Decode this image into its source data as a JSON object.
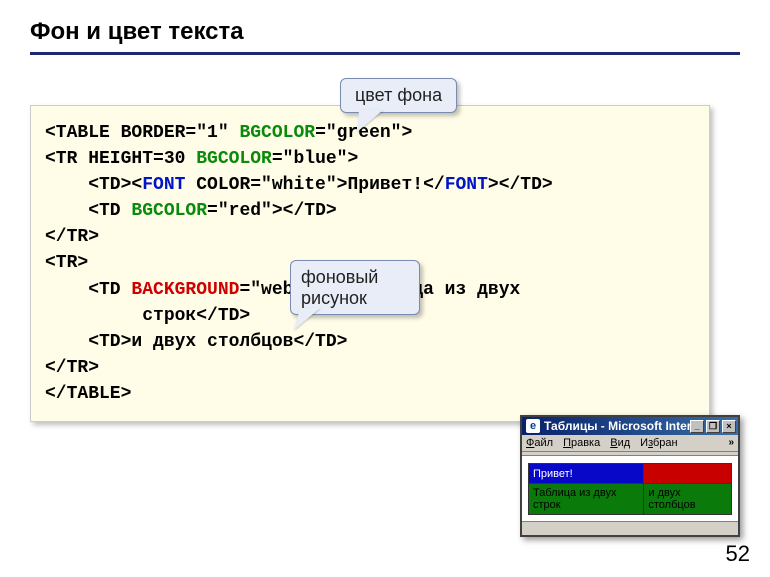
{
  "title": "Фон и цвет текста",
  "pagenum": "52",
  "callouts": {
    "c1": "цвет фона",
    "c2": "фоновый рисунок"
  },
  "code": {
    "l1a": "<TABLE BORDER=\"1\" ",
    "l1b": "BGCOLOR",
    "l1c": "=\"green\">",
    "l2a": "<TR HEIGHT=30 ",
    "l2b": "BGCOLOR",
    "l2c": "=\"blue\">",
    "l3a": "    <TD><",
    "l3b": "FONT",
    "l3c": " COLOR=\"white\">Привет!</",
    "l3d": "FONT",
    "l3e": "></TD>",
    "l4a": "    <TD ",
    "l4b": "BGCOLOR",
    "l4c": "=\"red\"></TD>",
    "l5": "</TR>",
    "l6": "<TR>",
    "l7a": "    <TD ",
    "l7b": "BACKGROUND",
    "l7c": "=\"web.jpg\">Таблица из двух",
    "l7d": "         строк</TD>",
    "l8": "    <TD>и двух столбцов</TD>",
    "l9": "</TR>",
    "l10": "</TABLE>"
  },
  "ie": {
    "icon": "e",
    "title": "Таблицы - Microsoft Intern...",
    "min": "_",
    "max": "❐",
    "close": "×",
    "menu": {
      "file": "Файл",
      "edit": "Правка",
      "view": "Вид",
      "fav": "Избран",
      "chev": "»"
    },
    "cells": {
      "a1": "Привет!",
      "a2": "",
      "b1": "Таблица из двух строк",
      "b2": "и двух столбцов"
    }
  }
}
